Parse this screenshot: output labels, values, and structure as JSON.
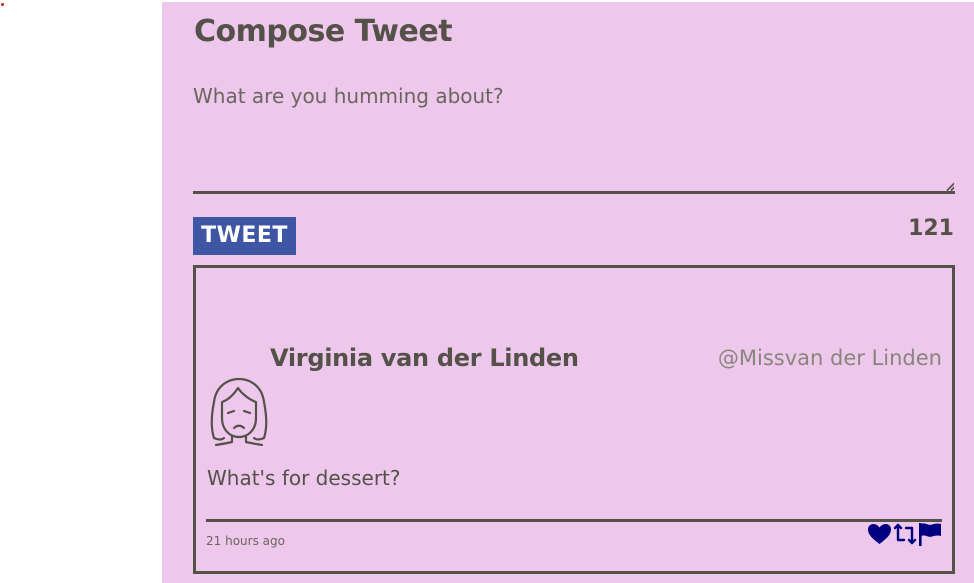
{
  "compose": {
    "title": "Compose Tweet",
    "placeholder": "What are you humming about?",
    "value": "",
    "submit_label": "TWEET",
    "char_counter": "121"
  },
  "tweets": [
    {
      "avatar_icon": "girl-face-icon",
      "display_name": "Virginia van der Linden",
      "handle": "@Missvan der Linden",
      "content": "What's for dessert?",
      "timestamp": "21 hours ago",
      "actions": [
        "heart-icon",
        "retweet-icon",
        "flag-icon"
      ]
    }
  ],
  "colors": {
    "panel_background": "#eec8ec",
    "text": "#545149",
    "handle_text": "#8a857c",
    "button_background": "#3e56a4",
    "button_text": "#ffffff",
    "action_icons": "#000080",
    "indicator_dot": "#cc2222"
  }
}
